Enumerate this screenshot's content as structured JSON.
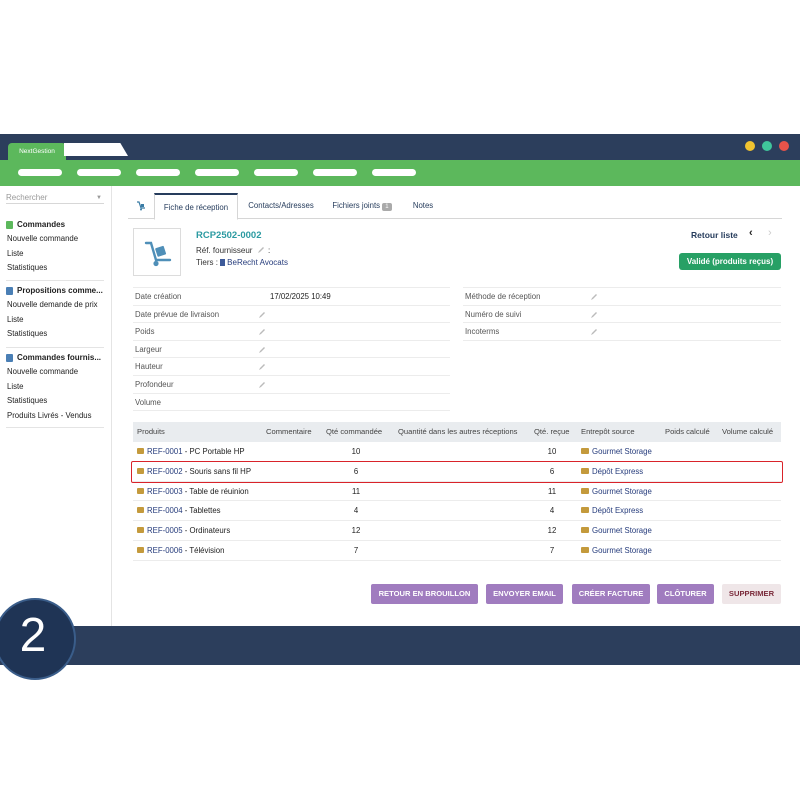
{
  "app": {
    "tab_label": "NextGestion",
    "window_dots": [
      "#f0c330",
      "#40c69b",
      "#e8534a"
    ]
  },
  "sidebar": {
    "search_placeholder": "Rechercher",
    "groups": [
      {
        "title": "Commandes",
        "items": [
          "Nouvelle commande",
          "Liste",
          "Statistiques"
        ]
      },
      {
        "title": "Propositions comme...",
        "items": [
          "Nouvelle demande de prix",
          "Liste",
          "Statistiques"
        ]
      },
      {
        "title": "Commandes fournis...",
        "items": [
          "Nouvelle commande",
          "Liste",
          "Statistiques",
          "Produits Livrés - Vendus"
        ]
      }
    ]
  },
  "tabs": {
    "main": "Fiche de réception",
    "contacts": "Contacts/Adresses",
    "files": "Fichiers joints",
    "files_count": "1",
    "notes": "Notes"
  },
  "header": {
    "ref": "RCP2502-0002",
    "ref_fournisseur_label": "Réf. fournisseur",
    "ref_fournisseur_sep": ":",
    "tiers_label": "Tiers :",
    "tiers_value": "BeRecht Avocats",
    "retour_label": "Retour liste",
    "prev": "‹",
    "next": "›",
    "status": "Validé (produits reçus)"
  },
  "fields_left": [
    {
      "label": "Date création",
      "value": "17/02/2025 10:49",
      "editable": false
    },
    {
      "label": "Date prévue de livraison",
      "value": "",
      "editable": true
    },
    {
      "label": "Poids",
      "value": "",
      "editable": true
    },
    {
      "label": "Largeur",
      "value": "",
      "editable": true
    },
    {
      "label": "Hauteur",
      "value": "",
      "editable": true
    },
    {
      "label": "Profondeur",
      "value": "",
      "editable": true
    },
    {
      "label": "Volume",
      "value": "",
      "editable": false
    }
  ],
  "fields_right": [
    {
      "label": "Méthode de réception",
      "value": "",
      "editable": true
    },
    {
      "label": "Numéro de suivi",
      "value": "",
      "editable": true
    },
    {
      "label": "Incoterms",
      "value": "",
      "editable": true
    }
  ],
  "table": {
    "columns": [
      "Produits",
      "Commentaire",
      "Qté commandée",
      "Quantité dans les autres réceptions",
      "Qté. reçue",
      "Entrepôt source",
      "Poids calculé",
      "Volume calculé"
    ],
    "rows": [
      {
        "ref": "REF-0001",
        "label": "PC Portable HP",
        "qty_ordered": "10",
        "qty_received": "10",
        "warehouse": "Gourmet Storage"
      },
      {
        "ref": "REF-0002",
        "label": "Souris sans fil HP",
        "qty_ordered": "6",
        "qty_received": "6",
        "warehouse": "Dépôt Express"
      },
      {
        "ref": "REF-0003",
        "label": "Table de réuinion",
        "qty_ordered": "11",
        "qty_received": "11",
        "warehouse": "Gourmet Storage"
      },
      {
        "ref": "REF-0004",
        "label": "Tablettes",
        "qty_ordered": "4",
        "qty_received": "4",
        "warehouse": "Dépôt Express"
      },
      {
        "ref": "REF-0005",
        "label": "Ordinateurs",
        "qty_ordered": "12",
        "qty_received": "12",
        "warehouse": "Gourmet Storage"
      },
      {
        "ref": "REF-0006",
        "label": "Télévision",
        "qty_ordered": "7",
        "qty_received": "7",
        "warehouse": "Gourmet Storage"
      }
    ],
    "highlighted_row": 1
  },
  "actions": {
    "draft": "RETOUR EN BROUILLON",
    "email": "ENVOYER EMAIL",
    "invoice": "CRÉER FACTURE",
    "close": "CLÔTURER",
    "delete": "SUPPRIMER"
  },
  "step": {
    "number": "2"
  },
  "colors": {
    "nav": "#2c3e5c",
    "green": "#5cb85c",
    "status": "#27a065",
    "action": "#a07cbf",
    "highlight": "#d9232a",
    "link": "#2b9aa1"
  }
}
